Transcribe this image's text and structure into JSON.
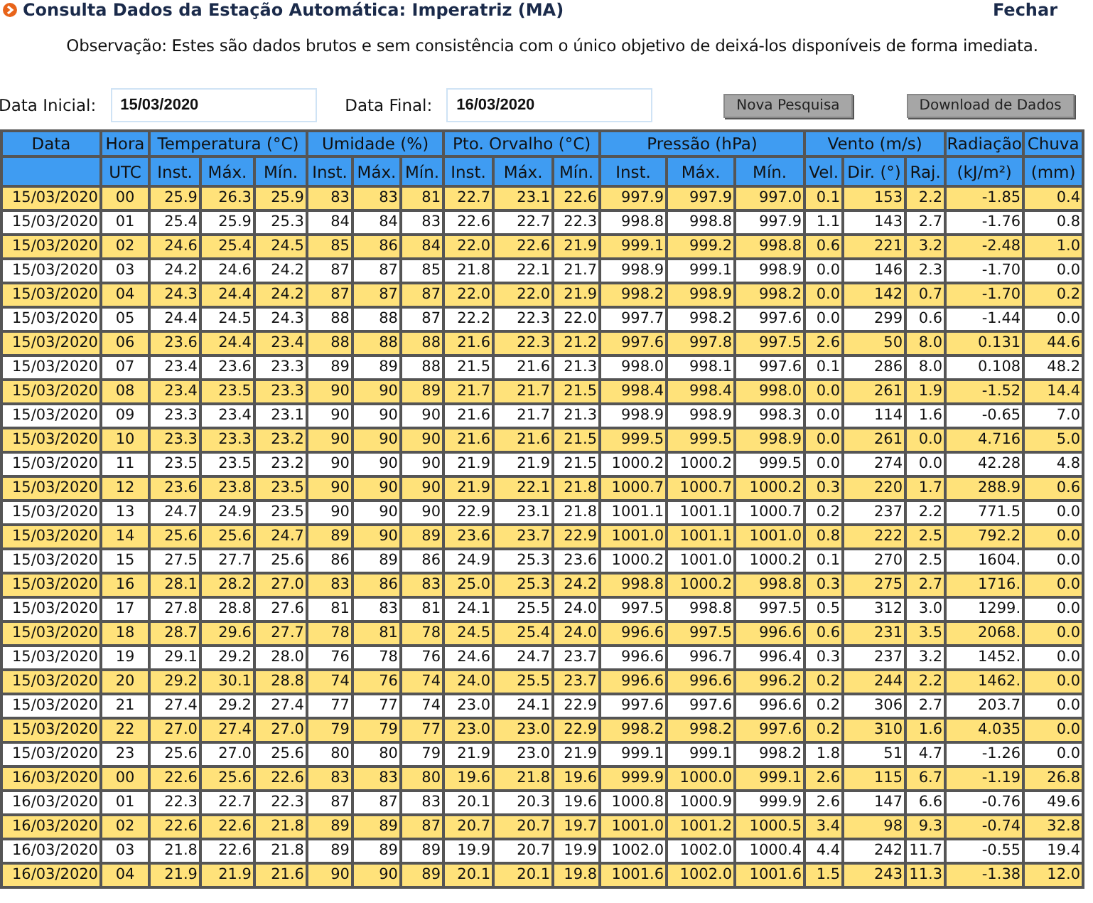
{
  "header": {
    "title": "Consulta Dados da Estação Automática: Imperatriz (MA)",
    "close_link": "Fechar"
  },
  "note": "Observação: Estes são dados brutos e sem consistência com o único objetivo de deixá-los disponíveis de forma imediata.",
  "filters": {
    "start_label": "Data Inicial:",
    "start_value": "15/03/2020",
    "end_label": "Data Final:",
    "end_value": "16/03/2020",
    "buttons": [
      "Nova Pesquisa",
      "Download de Dados"
    ]
  },
  "table": {
    "groups": [
      "Data",
      "Hora",
      "Temperatura (°C)",
      "Umidade (%)",
      "Pto. Orvalho (°C)",
      "Pressão (hPa)",
      "Vento (m/s)",
      "Radiação",
      "Chuva"
    ],
    "columns": [
      "",
      "UTC",
      "Inst.",
      "Máx.",
      "Mín.",
      "Inst.",
      "Máx.",
      "Mín.",
      "Inst.",
      "Máx.",
      "Mín.",
      "Inst.",
      "Máx.",
      "Mín.",
      "Vel.",
      "Dir. (°)",
      "Raj.",
      "(kJ/m²)",
      "(mm)"
    ],
    "rows": [
      {
        "highlighted": true,
        "cells": [
          "15/03/2020",
          "00",
          "25.9",
          "26.3",
          "25.9",
          "83",
          "83",
          "81",
          "22.7",
          "23.1",
          "22.6",
          "997.9",
          "997.9",
          "997.0",
          "0.1",
          "153",
          "2.2",
          "-1.85",
          "0.4"
        ]
      },
      {
        "highlighted": false,
        "cells": [
          "15/03/2020",
          "01",
          "25.4",
          "25.9",
          "25.3",
          "84",
          "84",
          "83",
          "22.6",
          "22.7",
          "22.3",
          "998.8",
          "998.8",
          "997.9",
          "1.1",
          "143",
          "2.7",
          "-1.76",
          "0.8"
        ]
      },
      {
        "highlighted": true,
        "cells": [
          "15/03/2020",
          "02",
          "24.6",
          "25.4",
          "24.5",
          "85",
          "86",
          "84",
          "22.0",
          "22.6",
          "21.9",
          "999.1",
          "999.2",
          "998.8",
          "0.6",
          "221",
          "3.2",
          "-2.48",
          "1.0"
        ]
      },
      {
        "highlighted": false,
        "cells": [
          "15/03/2020",
          "03",
          "24.2",
          "24.6",
          "24.2",
          "87",
          "87",
          "85",
          "21.8",
          "22.1",
          "21.7",
          "998.9",
          "999.1",
          "998.9",
          "0.0",
          "146",
          "2.3",
          "-1.70",
          "0.0"
        ]
      },
      {
        "highlighted": true,
        "cells": [
          "15/03/2020",
          "04",
          "24.3",
          "24.4",
          "24.2",
          "87",
          "87",
          "87",
          "22.0",
          "22.0",
          "21.9",
          "998.2",
          "998.9",
          "998.2",
          "0.0",
          "142",
          "0.7",
          "-1.70",
          "0.2"
        ]
      },
      {
        "highlighted": false,
        "cells": [
          "15/03/2020",
          "05",
          "24.4",
          "24.5",
          "24.3",
          "88",
          "88",
          "87",
          "22.2",
          "22.3",
          "22.0",
          "997.7",
          "998.2",
          "997.6",
          "0.0",
          "299",
          "0.6",
          "-1.44",
          "0.0"
        ]
      },
      {
        "highlighted": true,
        "cells": [
          "15/03/2020",
          "06",
          "23.6",
          "24.4",
          "23.4",
          "88",
          "88",
          "88",
          "21.6",
          "22.3",
          "21.2",
          "997.6",
          "997.8",
          "997.5",
          "2.6",
          "50",
          "8.0",
          "0.131",
          "44.6"
        ]
      },
      {
        "highlighted": false,
        "cells": [
          "15/03/2020",
          "07",
          "23.4",
          "23.6",
          "23.3",
          "89",
          "89",
          "88",
          "21.5",
          "21.6",
          "21.3",
          "998.0",
          "998.1",
          "997.6",
          "0.1",
          "286",
          "8.0",
          "0.108",
          "48.2"
        ]
      },
      {
        "highlighted": true,
        "cells": [
          "15/03/2020",
          "08",
          "23.4",
          "23.5",
          "23.3",
          "90",
          "90",
          "89",
          "21.7",
          "21.7",
          "21.5",
          "998.4",
          "998.4",
          "998.0",
          "0.0",
          "261",
          "1.9",
          "-1.52",
          "14.4"
        ]
      },
      {
        "highlighted": false,
        "cells": [
          "15/03/2020",
          "09",
          "23.3",
          "23.4",
          "23.1",
          "90",
          "90",
          "90",
          "21.6",
          "21.7",
          "21.3",
          "998.9",
          "998.9",
          "998.3",
          "0.0",
          "114",
          "1.6",
          "-0.65",
          "7.0"
        ]
      },
      {
        "highlighted": true,
        "cells": [
          "15/03/2020",
          "10",
          "23.3",
          "23.3",
          "23.2",
          "90",
          "90",
          "90",
          "21.6",
          "21.6",
          "21.5",
          "999.5",
          "999.5",
          "998.9",
          "0.0",
          "261",
          "0.0",
          "4.716",
          "5.0"
        ]
      },
      {
        "highlighted": false,
        "cells": [
          "15/03/2020",
          "11",
          "23.5",
          "23.5",
          "23.2",
          "90",
          "90",
          "90",
          "21.9",
          "21.9",
          "21.5",
          "1000.2",
          "1000.2",
          "999.5",
          "0.0",
          "274",
          "0.0",
          "42.28",
          "4.8"
        ]
      },
      {
        "highlighted": true,
        "cells": [
          "15/03/2020",
          "12",
          "23.6",
          "23.8",
          "23.5",
          "90",
          "90",
          "90",
          "21.9",
          "22.1",
          "21.8",
          "1000.7",
          "1000.7",
          "1000.2",
          "0.3",
          "220",
          "1.7",
          "288.9",
          "0.6"
        ]
      },
      {
        "highlighted": false,
        "cells": [
          "15/03/2020",
          "13",
          "24.7",
          "24.9",
          "23.5",
          "90",
          "90",
          "90",
          "22.9",
          "23.1",
          "21.8",
          "1001.1",
          "1001.1",
          "1000.7",
          "0.2",
          "237",
          "2.2",
          "771.5",
          "0.0"
        ]
      },
      {
        "highlighted": true,
        "cells": [
          "15/03/2020",
          "14",
          "25.6",
          "25.6",
          "24.7",
          "89",
          "90",
          "89",
          "23.6",
          "23.7",
          "22.9",
          "1001.0",
          "1001.1",
          "1001.0",
          "0.8",
          "222",
          "2.5",
          "792.2",
          "0.0"
        ]
      },
      {
        "highlighted": false,
        "cells": [
          "15/03/2020",
          "15",
          "27.5",
          "27.7",
          "25.6",
          "86",
          "89",
          "86",
          "24.9",
          "25.3",
          "23.6",
          "1000.2",
          "1001.0",
          "1000.2",
          "0.1",
          "270",
          "2.5",
          "1604.",
          "0.0"
        ]
      },
      {
        "highlighted": true,
        "cells": [
          "15/03/2020",
          "16",
          "28.1",
          "28.2",
          "27.0",
          "83",
          "86",
          "83",
          "25.0",
          "25.3",
          "24.2",
          "998.8",
          "1000.2",
          "998.8",
          "0.3",
          "275",
          "2.7",
          "1716.",
          "0.0"
        ]
      },
      {
        "highlighted": false,
        "cells": [
          "15/03/2020",
          "17",
          "27.8",
          "28.8",
          "27.6",
          "81",
          "83",
          "81",
          "24.1",
          "25.5",
          "24.0",
          "997.5",
          "998.8",
          "997.5",
          "0.5",
          "312",
          "3.0",
          "1299.",
          "0.0"
        ]
      },
      {
        "highlighted": true,
        "cells": [
          "15/03/2020",
          "18",
          "28.7",
          "29.6",
          "27.7",
          "78",
          "81",
          "78",
          "24.5",
          "25.4",
          "24.0",
          "996.6",
          "997.5",
          "996.6",
          "0.6",
          "231",
          "3.5",
          "2068.",
          "0.0"
        ]
      },
      {
        "highlighted": false,
        "cells": [
          "15/03/2020",
          "19",
          "29.1",
          "29.2",
          "28.0",
          "76",
          "78",
          "76",
          "24.6",
          "24.7",
          "23.7",
          "996.6",
          "996.7",
          "996.4",
          "0.3",
          "237",
          "3.2",
          "1452.",
          "0.0"
        ]
      },
      {
        "highlighted": true,
        "cells": [
          "15/03/2020",
          "20",
          "29.2",
          "30.1",
          "28.8",
          "74",
          "76",
          "74",
          "24.0",
          "25.5",
          "23.7",
          "996.6",
          "996.6",
          "996.2",
          "0.2",
          "244",
          "2.2",
          "1462.",
          "0.0"
        ]
      },
      {
        "highlighted": false,
        "cells": [
          "15/03/2020",
          "21",
          "27.4",
          "29.2",
          "27.4",
          "77",
          "77",
          "74",
          "23.0",
          "24.1",
          "22.9",
          "997.6",
          "997.6",
          "996.6",
          "0.2",
          "306",
          "2.7",
          "203.7",
          "0.0"
        ]
      },
      {
        "highlighted": true,
        "cells": [
          "15/03/2020",
          "22",
          "27.0",
          "27.4",
          "27.0",
          "79",
          "79",
          "77",
          "23.0",
          "23.0",
          "22.9",
          "998.2",
          "998.2",
          "997.6",
          "0.2",
          "310",
          "1.6",
          "4.035",
          "0.0"
        ]
      },
      {
        "highlighted": false,
        "cells": [
          "15/03/2020",
          "23",
          "25.6",
          "27.0",
          "25.6",
          "80",
          "80",
          "79",
          "21.9",
          "23.0",
          "21.9",
          "999.1",
          "999.1",
          "998.2",
          "1.8",
          "51",
          "4.7",
          "-1.26",
          "0.0"
        ]
      },
      {
        "highlighted": true,
        "cells": [
          "16/03/2020",
          "00",
          "22.6",
          "25.6",
          "22.6",
          "83",
          "83",
          "80",
          "19.6",
          "21.8",
          "19.6",
          "999.9",
          "1000.0",
          "999.1",
          "2.6",
          "115",
          "6.7",
          "-1.19",
          "26.8"
        ]
      },
      {
        "highlighted": false,
        "cells": [
          "16/03/2020",
          "01",
          "22.3",
          "22.7",
          "22.3",
          "87",
          "87",
          "83",
          "20.1",
          "20.3",
          "19.6",
          "1000.8",
          "1000.9",
          "999.9",
          "2.6",
          "147",
          "6.6",
          "-0.76",
          "49.6"
        ]
      },
      {
        "highlighted": true,
        "cells": [
          "16/03/2020",
          "02",
          "22.6",
          "22.6",
          "21.8",
          "89",
          "89",
          "87",
          "20.7",
          "20.7",
          "19.7",
          "1001.0",
          "1001.2",
          "1000.5",
          "3.4",
          "98",
          "9.3",
          "-0.74",
          "32.8"
        ]
      },
      {
        "highlighted": false,
        "cells": [
          "16/03/2020",
          "03",
          "21.8",
          "22.6",
          "21.8",
          "89",
          "89",
          "89",
          "19.9",
          "20.7",
          "19.9",
          "1002.0",
          "1002.0",
          "1000.4",
          "4.4",
          "242",
          "11.7",
          "-0.55",
          "19.4"
        ]
      },
      {
        "highlighted": true,
        "cells": [
          "16/03/2020",
          "04",
          "21.9",
          "21.9",
          "21.6",
          "90",
          "90",
          "89",
          "20.1",
          "20.1",
          "19.8",
          "1001.6",
          "1002.0",
          "1001.6",
          "1.5",
          "243",
          "11.3",
          "-1.38",
          "12.0"
        ]
      }
    ]
  }
}
